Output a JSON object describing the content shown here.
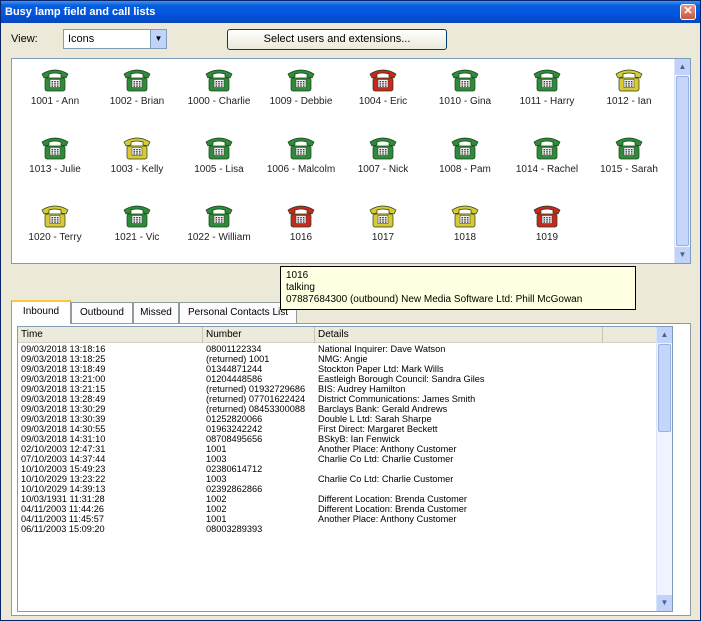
{
  "window": {
    "title": "Busy lamp field and call lists"
  },
  "toolbar": {
    "view_label": "View:",
    "view_value": "Icons",
    "select_button": "Select users and extensions..."
  },
  "colors": {
    "idle": "#2e8b3a",
    "ringing": "#d9c933",
    "busy": "#c8281e"
  },
  "blf": [
    {
      "label": "1001 - Ann",
      "status": "idle"
    },
    {
      "label": "1002 - Brian",
      "status": "idle"
    },
    {
      "label": "1000 - Charlie",
      "status": "idle"
    },
    {
      "label": "1009 - Debbie",
      "status": "idle"
    },
    {
      "label": "1004 - Eric",
      "status": "busy"
    },
    {
      "label": "1010 - Gina",
      "status": "idle"
    },
    {
      "label": "1011 - Harry",
      "status": "idle"
    },
    {
      "label": "1012 - Ian",
      "status": "ringing"
    },
    {
      "label": "1013 - Julie",
      "status": "idle"
    },
    {
      "label": "1003 - Kelly",
      "status": "ringing"
    },
    {
      "label": "1005 - Lisa",
      "status": "idle"
    },
    {
      "label": "1006 - Malcolm",
      "status": "idle"
    },
    {
      "label": "1007 - Nick",
      "status": "idle"
    },
    {
      "label": "1008 - Pam",
      "status": "idle"
    },
    {
      "label": "1014 - Rachel",
      "status": "idle"
    },
    {
      "label": "1015 - Sarah",
      "status": "idle"
    },
    {
      "label": "1020 - Terry",
      "status": "ringing"
    },
    {
      "label": "1021 - Vic",
      "status": "idle"
    },
    {
      "label": "1022 - William",
      "status": "idle"
    },
    {
      "label": "1016",
      "status": "busy"
    },
    {
      "label": "1017",
      "status": "ringing"
    },
    {
      "label": "1018",
      "status": "ringing"
    },
    {
      "label": "1019",
      "status": "busy"
    }
  ],
  "tooltip": {
    "line1": "1016",
    "line2": "talking",
    "line3": "07887684300 (outbound) New Media Software Ltd: Phill McGowan"
  },
  "tabs": [
    "Inbound",
    "Outbound",
    "Missed",
    "Personal Contacts List"
  ],
  "list": {
    "columns": [
      "Time",
      "Number",
      "Details"
    ],
    "rows": [
      [
        "09/03/2018 13:18:16",
        "08001122334",
        "National Inquirer: Dave Watson"
      ],
      [
        "09/03/2018 13:18:25",
        "(returned) 1001",
        "NMG: Angie"
      ],
      [
        "09/03/2018 13:18:49",
        "01344871244",
        "Stockton Paper Ltd: Mark Wills"
      ],
      [
        "09/03/2018 13:21:00",
        "01204448586",
        "Eastleigh Borough Council: Sandra Giles"
      ],
      [
        "09/03/2018 13:21:15",
        "(returned) 01932729686",
        "BIS: Audrey Hamilton"
      ],
      [
        "09/03/2018 13:28:49",
        "(returned) 07701622424",
        "District Communications: James Smith"
      ],
      [
        "09/03/2018 13:30:29",
        "(returned) 08453300088",
        "Barclays Bank: Gerald Andrews"
      ],
      [
        "09/03/2018 13:30:39",
        "01252820066",
        "Double L Ltd: Sarah Sharpe"
      ],
      [
        "09/03/2018 14:30:55",
        "01963242242",
        "First Direct: Margaret Beckett"
      ],
      [
        "09/03/2018 14:31:10",
        "08708495656",
        "BSkyB: Ian Fenwick"
      ],
      [
        "02/10/2003 12:47:31",
        "1001",
        "Another Place: Anthony Customer"
      ],
      [
        "07/10/2003 14:37:44",
        "1003",
        "Charlie Co Ltd: Charlie Customer"
      ],
      [
        "10/10/2003 15:49:23",
        "02380614712",
        ""
      ],
      [
        "10/10/2029 13:23:22",
        "1003",
        "Charlie Co Ltd: Charlie Customer"
      ],
      [
        "10/10/2029 14:39:13",
        "02392862866",
        ""
      ],
      [
        "10/03/1931 11:31:28",
        "1002",
        "Different Location: Brenda Customer"
      ],
      [
        "04/11/2003 11:44:26",
        "1002",
        "Different Location: Brenda Customer"
      ],
      [
        "04/11/2003 11:45:57",
        "1001",
        "Another Place: Anthony Customer"
      ],
      [
        "06/11/2003 15:09:20",
        "08003289393",
        ""
      ]
    ]
  }
}
